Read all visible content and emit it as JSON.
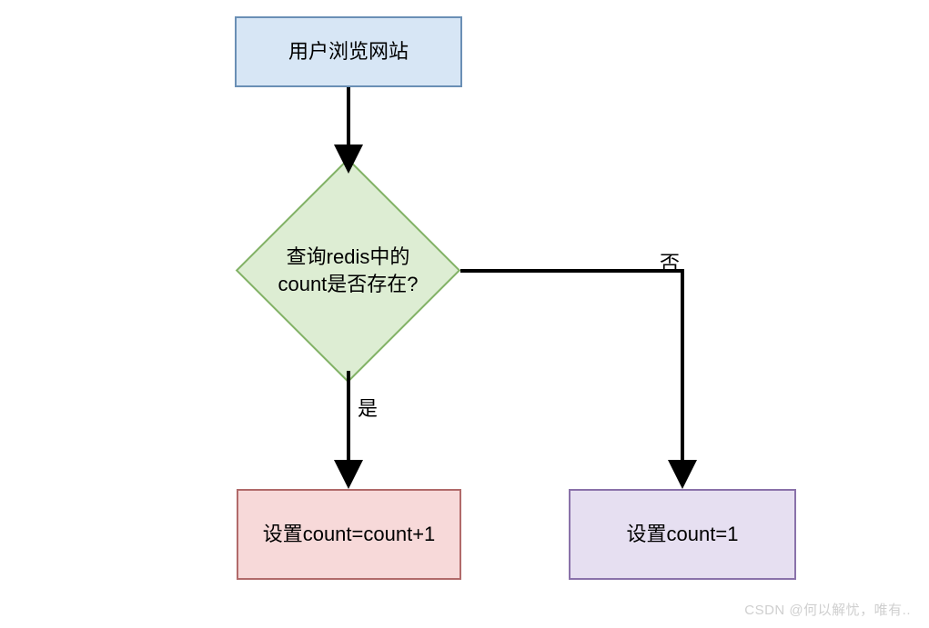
{
  "nodes": {
    "start": {
      "label": "用户浏览网站"
    },
    "decision": {
      "label": "查询redis中的count是否存在?"
    },
    "yesAction": {
      "label": "设置count=count+1"
    },
    "noAction": {
      "label": "设置count=1"
    }
  },
  "edges": {
    "yesLabel": "是",
    "noLabel": "否"
  },
  "watermark": "CSDN @何以解忧，唯有..",
  "colors": {
    "startFill": "#d7e6f5",
    "startStroke": "#6a8fb5",
    "decisionFill": "#ddedd3",
    "decisionStroke": "#82b266",
    "yesFill": "#f7d9d9",
    "yesStroke": "#b16a6a",
    "noFill": "#e6dff1",
    "noStroke": "#8a72aa"
  }
}
